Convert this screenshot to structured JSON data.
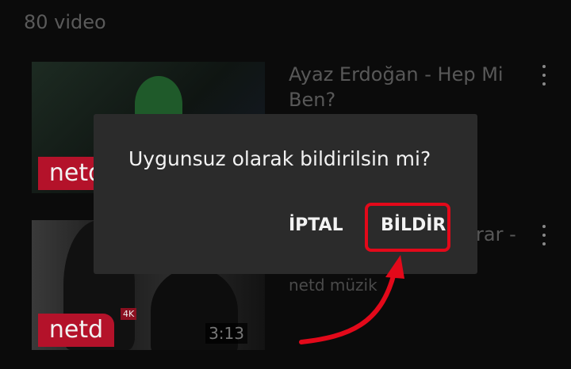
{
  "header": {
    "video_count": "80 video"
  },
  "videos": [
    {
      "title_line1": "Ayaz Erdoğan - Hep Mi",
      "title_line2": "Ben?",
      "logo": "netd",
      "channel": ""
    },
    {
      "title_partial": "rar -",
      "logo": "netd",
      "badge": "4K",
      "duration": "3:13",
      "channel": "netd müzik"
    }
  ],
  "dialog": {
    "message": "Uygunsuz olarak bildirilsin mi?",
    "cancel_label": "İPTAL",
    "report_label": "BİLDİR"
  },
  "colors": {
    "annotation": "#e3091a",
    "dialog_bg": "#2b2b2b"
  },
  "icons": [
    "more-vert-icon",
    "annotation-arrow"
  ]
}
